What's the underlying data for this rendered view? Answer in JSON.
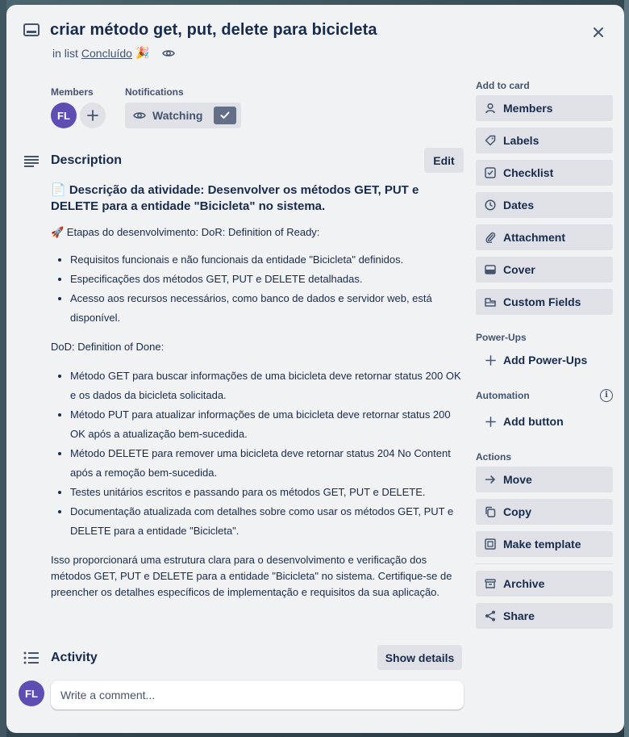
{
  "card": {
    "title": "criar método get, put, delete para bicicleta",
    "in_list_prefix": "in list",
    "list_name": "Concluído",
    "list_emoji": "🎉"
  },
  "members": {
    "label": "Members",
    "avatar_initials": "FL"
  },
  "notifications": {
    "label": "Notifications",
    "watching_label": "Watching"
  },
  "description": {
    "title": "Description",
    "edit_label": "Edit",
    "heading": "📄 Descrição da atividade: Desenvolver os métodos GET, PUT e DELETE para a entidade \"Bicicleta\" no sistema.",
    "steps_line": "🚀 Etapas do desenvolvimento: DoR: Definition of Ready:",
    "dor_items": [
      "Requisitos funcionais e não funcionais da entidade \"Bicicleta\" definidos.",
      "Especificações dos métodos GET, PUT e DELETE detalhadas.",
      "Acesso aos recursos necessários, como banco de dados e servidor web, está disponível."
    ],
    "dod_line": "DoD: Definition of Done:",
    "dod_items": [
      "Método GET para buscar informações de uma bicicleta deve retornar status 200 OK e os dados da bicicleta solicitada.",
      "Método PUT para atualizar informações de uma bicicleta deve retornar status 200 OK após a atualização bem-sucedida.",
      "Método DELETE para remover uma bicicleta deve retornar status 204 No Content após a remoção bem-sucedida.",
      "Testes unitários escritos e passando para os métodos GET, PUT e DELETE.",
      "Documentação atualizada com detalhes sobre como usar os métodos GET, PUT e DELETE para a entidade \"Bicicleta\"."
    ],
    "final_paragraph": "Isso proporcionará uma estrutura clara para o desenvolvimento e verificação dos métodos GET, PUT e DELETE para a entidade \"Bicicleta\" no sistema. Certifique-se de preencher os detalhes específicos de implementação e requisitos da sua aplicação."
  },
  "activity": {
    "title": "Activity",
    "show_details_label": "Show details",
    "comment_placeholder": "Write a comment...",
    "avatar_initials": "FL"
  },
  "sidebar": {
    "add_to_card_label": "Add to card",
    "add_to_card": [
      {
        "label": "Members",
        "icon": "person-icon"
      },
      {
        "label": "Labels",
        "icon": "tag-icon"
      },
      {
        "label": "Checklist",
        "icon": "checklist-icon"
      },
      {
        "label": "Dates",
        "icon": "clock-icon"
      },
      {
        "label": "Attachment",
        "icon": "paperclip-icon"
      },
      {
        "label": "Cover",
        "icon": "cover-icon"
      },
      {
        "label": "Custom Fields",
        "icon": "custom-fields-icon"
      }
    ],
    "powerups_label": "Power-Ups",
    "add_powerups_label": "Add Power-Ups",
    "automation_label": "Automation",
    "add_button_label": "Add button",
    "actions_label": "Actions",
    "actions": [
      {
        "label": "Move",
        "icon": "arrow-right-icon"
      },
      {
        "label": "Copy",
        "icon": "copy-icon"
      },
      {
        "label": "Make template",
        "icon": "template-icon"
      }
    ],
    "more_actions": [
      {
        "label": "Archive",
        "icon": "archive-icon"
      },
      {
        "label": "Share",
        "icon": "share-icon"
      }
    ]
  },
  "colors": {
    "modal_bg": "#f1f2f4",
    "button_bg": "#dfe1e6",
    "avatar_bg": "#5e4db2",
    "text": "#172b4d",
    "subtle_text": "#44546f"
  }
}
